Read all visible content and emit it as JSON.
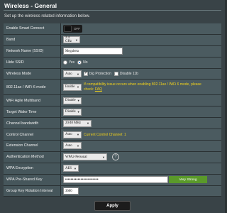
{
  "header": {
    "title": "Wireless - General",
    "subtitle": "Set up the wireless related information below."
  },
  "rows": {
    "smart_connect": {
      "label": "Enable Smart Connect",
      "toggle_text": "OFF"
    },
    "band": {
      "label": "Band",
      "value": "2.4 GHz"
    },
    "ssid": {
      "label": "Network Name (SSID)",
      "value": "Megabeta"
    },
    "hide_ssid": {
      "label": "Hide SSID",
      "yes": "Yes",
      "no": "No",
      "selected": "No"
    },
    "wireless_mode": {
      "label": "Wireless Mode",
      "value": "Auto",
      "bg_protection": "b/g Protection",
      "disable_11b": "Disable 11b"
    },
    "mode_80211ax": {
      "label": "802.11ax / WiFi 6 mode",
      "value": "Enable",
      "warning": "If compatibility issue occurs when enabling 802.11ax / WiFi 6 mode, please check:",
      "faq": "FAQ"
    },
    "agile_multiband": {
      "label": "WiFi Agile Multiband",
      "value": "Disable"
    },
    "target_wake": {
      "label": "Target Wake Time",
      "value": "Disable"
    },
    "channel_bw": {
      "label": "Channel bandwidth",
      "value": "20/40 MHz"
    },
    "control_channel": {
      "label": "Control Channel",
      "value": "Auto",
      "current": "Current Control Channel: 1"
    },
    "extension_channel": {
      "label": "Extension Channel",
      "value": "Auto"
    },
    "auth_method": {
      "label": "Authentication Method",
      "value": "WPA2-Personal"
    },
    "wpa_encryption": {
      "label": "WPA Encryption",
      "value": "AES"
    },
    "wpa_psk": {
      "label": "WPA Pre-Shared Key",
      "value": "••••••••••••••••••••••••",
      "strength": "Very Strong"
    },
    "group_key": {
      "label": "Group Key Rotation Interval",
      "value": "3600"
    }
  },
  "actions": {
    "apply": "Apply"
  },
  "colors": {
    "warning": "#f2d21a",
    "strength": "#5a9a2a",
    "panel": "#394347"
  }
}
